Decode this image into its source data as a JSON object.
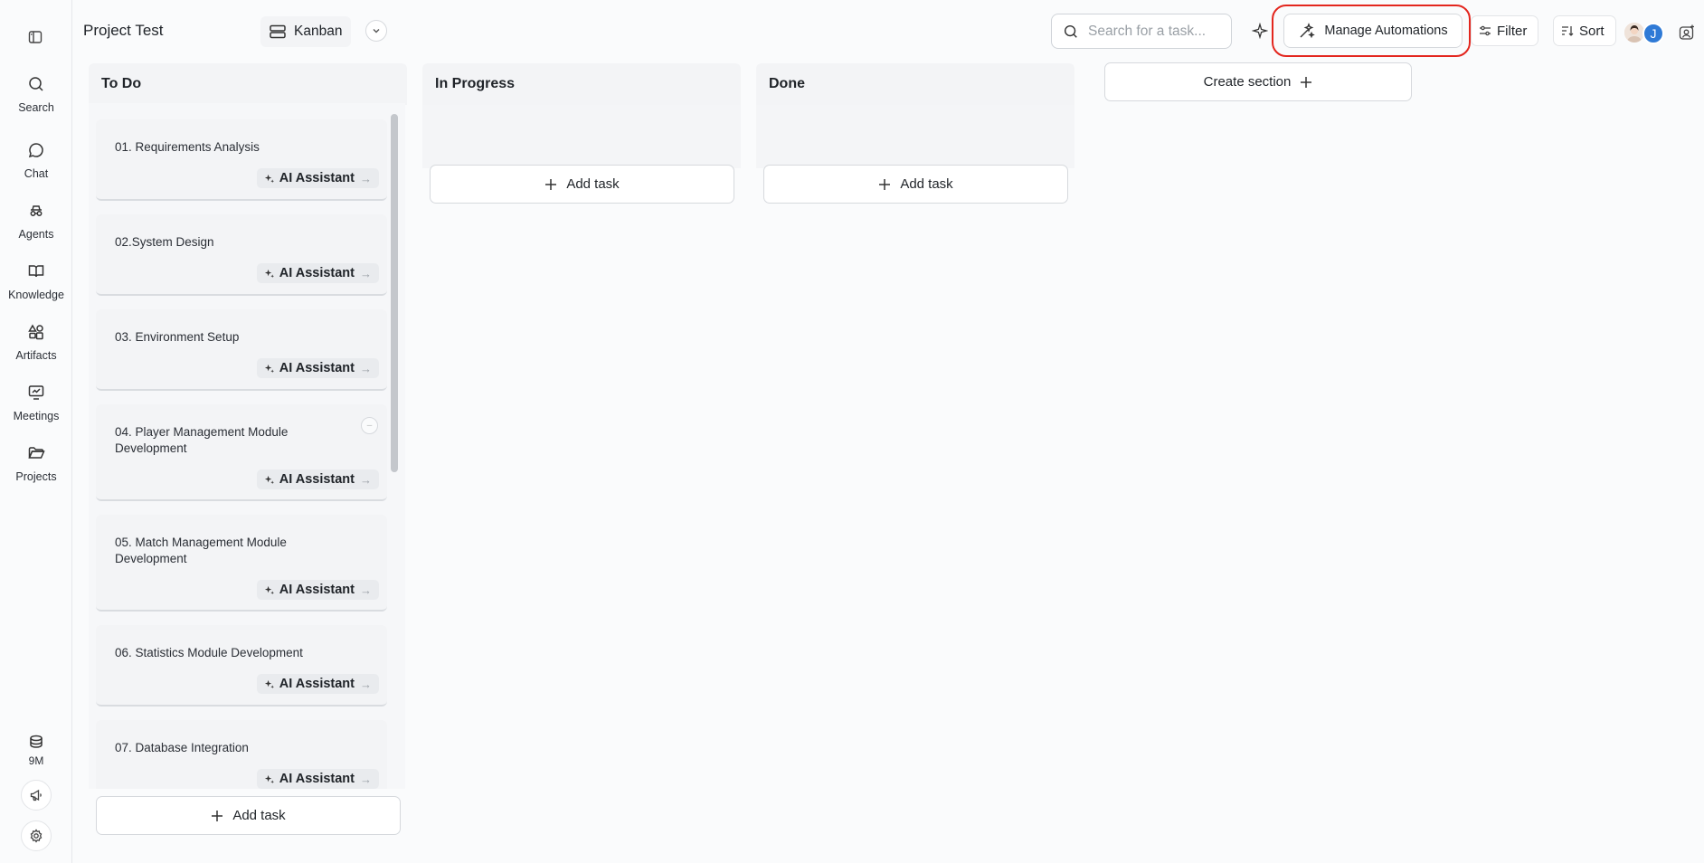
{
  "app": {
    "title": "Project Test"
  },
  "sidebar": {
    "items": [
      {
        "label": "Search",
        "icon": "search-icon"
      },
      {
        "label": "Chat",
        "icon": "chat-icon"
      },
      {
        "label": "Agents",
        "icon": "agents-icon"
      },
      {
        "label": "Knowledge",
        "icon": "book-icon"
      },
      {
        "label": "Artifacts",
        "icon": "shapes-icon"
      },
      {
        "label": "Meetings",
        "icon": "presentation-icon"
      },
      {
        "label": "Projects",
        "icon": "folder-icon"
      }
    ],
    "credits": "9M"
  },
  "toolbar": {
    "view_label": "Kanban",
    "search_placeholder": "Search for a task...",
    "manage_automations_label": "Manage Automations",
    "filter_label": "Filter",
    "sort_label": "Sort",
    "avatar_initial": "J"
  },
  "columns": [
    {
      "title": "To Do"
    },
    {
      "title": "In Progress"
    },
    {
      "title": "Done"
    }
  ],
  "add_task_label": "Add task",
  "create_section_label": "Create section",
  "tasks": [
    {
      "title": "01. Requirements Analysis",
      "chip": "AI Assistant"
    },
    {
      "title": "02.System Design",
      "chip": "AI Assistant"
    },
    {
      "title": "03. Environment Setup",
      "chip": "AI Assistant"
    },
    {
      "title": "04. Player Management Module Development",
      "chip": "AI Assistant"
    },
    {
      "title": "05. Match Management Module Development",
      "chip": "AI Assistant"
    },
    {
      "title": "06. Statistics Module Development",
      "chip": "AI Assistant"
    },
    {
      "title": "07. Database Integration",
      "chip": "AI Assistant"
    }
  ],
  "colors": {
    "highlight": "#e3261e",
    "avatar": "#2f7ad6"
  }
}
